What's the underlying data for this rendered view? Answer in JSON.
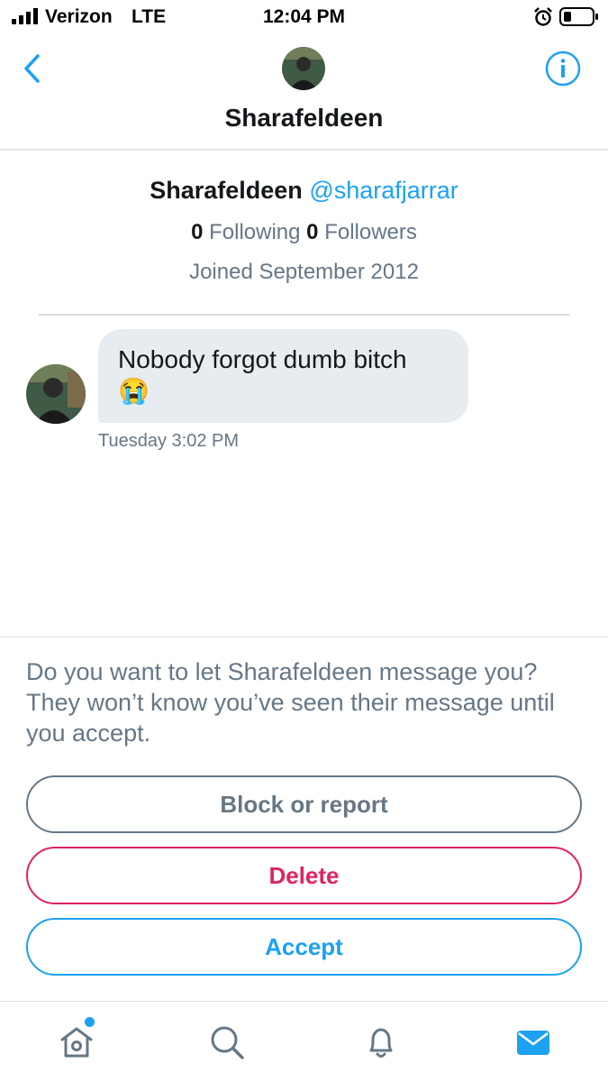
{
  "status_bar": {
    "carrier": "Verizon",
    "network": "LTE",
    "time": "12:04 PM"
  },
  "header": {
    "title": "Sharafeldeen",
    "back_icon": "chevron-left-icon",
    "info_icon": "info-icon"
  },
  "profile": {
    "name": "Sharafeldeen",
    "handle": "@sharafjarrar",
    "following_count": "0",
    "following_label": "Following",
    "followers_count": "0",
    "followers_label": "Followers",
    "joined": "Joined September 2012"
  },
  "message": {
    "text": "Nobody forgot dumb bitch",
    "emoji": "😭",
    "timestamp": "Tuesday 3:02 PM"
  },
  "request": {
    "prompt": "Do you want to let Sharafeldeen message you? They won’t know you’ve seen their message until you accept.",
    "block_label": "Block or report",
    "delete_label": "Delete",
    "accept_label": "Accept"
  },
  "tab_bar": {
    "icons": [
      "home-icon",
      "search-icon",
      "bell-icon",
      "mail-icon"
    ],
    "active": "mail-icon"
  },
  "colors": {
    "accent": "#1da1f2",
    "danger": "#e0245e",
    "muted": "#657786",
    "bubble": "#e6ecf0"
  }
}
